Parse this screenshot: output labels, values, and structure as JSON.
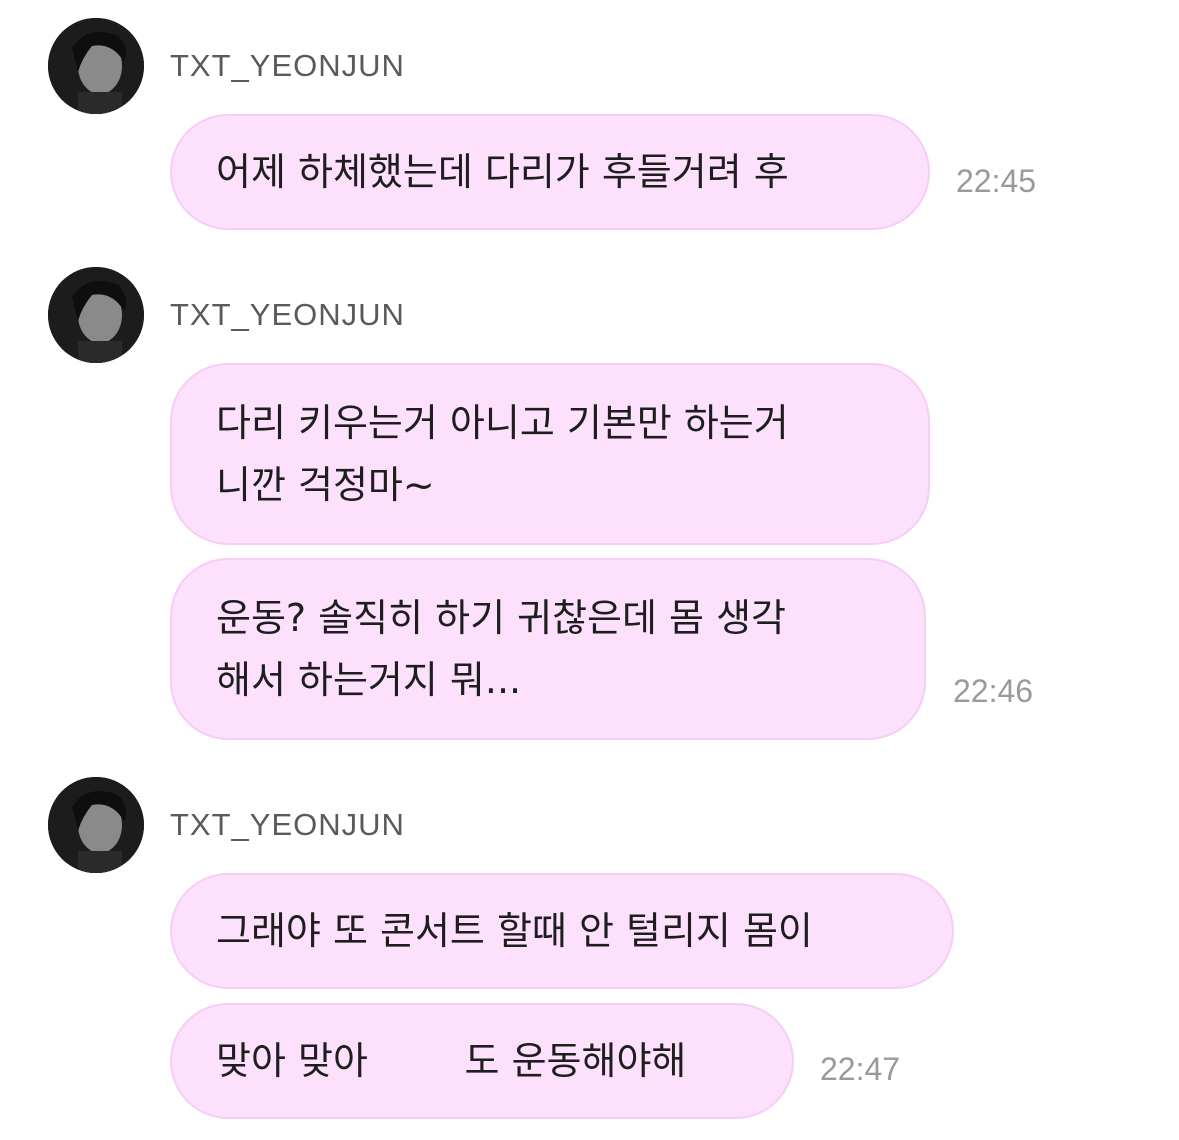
{
  "messages": [
    {
      "sender": "TXT_YEONJUN",
      "avatar_icon": "profile-photo-icon",
      "bubbles": [
        {
          "text": "어제 하체했는데 다리가 후들거려 후"
        }
      ],
      "time": "22:45"
    },
    {
      "sender": "TXT_YEONJUN",
      "avatar_icon": "profile-photo-icon",
      "bubbles": [
        {
          "text": "다리 키우는거 아니고 기본만 하는거\n니깐 걱정마~"
        },
        {
          "text": "운동? 솔직히 하기 귀찮은데 몸 생각\n해서 하는거지 뭐..."
        }
      ],
      "time": "22:46"
    },
    {
      "sender": "TXT_YEONJUN",
      "avatar_icon": "profile-photo-icon",
      "bubbles": [
        {
          "text": "그래야 또 콘서트 할때 안 털리지 몸이"
        },
        {
          "text": "맞아 맞아        도 운동해야해"
        }
      ],
      "time": "22:47"
    }
  ],
  "colors": {
    "bubble_bg": "#fce0fc",
    "bubble_border": "#f6cdf6",
    "sender_text": "#5a5a5a",
    "time_text": "#9a9a9a",
    "message_text": "#1e1e1e"
  }
}
